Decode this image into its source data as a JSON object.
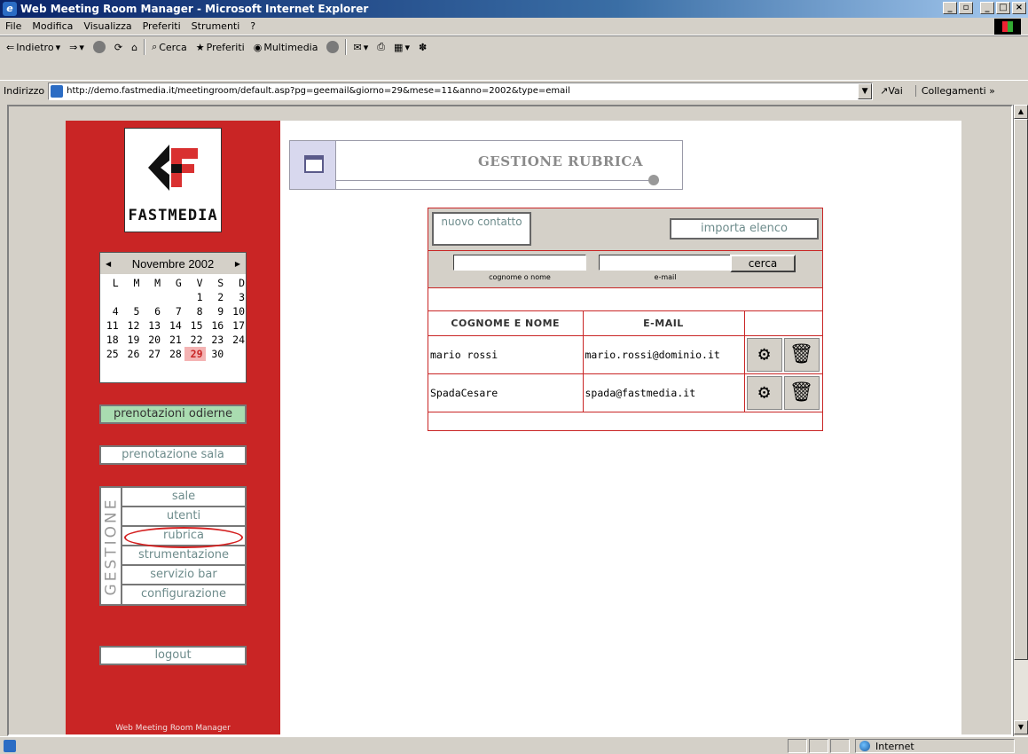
{
  "window": {
    "title": "Web Meeting Room Manager - Microsoft Internet Explorer"
  },
  "menu": [
    "File",
    "Modifica",
    "Visualizza",
    "Preferiti",
    "Strumenti",
    "?"
  ],
  "toolbar": {
    "back": "Indietro",
    "search": "Cerca",
    "favorites": "Preferiti",
    "media": "Multimedia"
  },
  "address": {
    "label": "Indirizzo",
    "url": "http://demo.fastmedia.it/meetingroom/default.asp?pg=geemail&giorno=29&mese=11&anno=2002&type=email",
    "go": "Vai",
    "links": "Collegamenti"
  },
  "sidebar": {
    "brand": "FASTMEDIA",
    "calendar": {
      "month": "Novembre 2002",
      "weekdays": [
        "L",
        "M",
        "M",
        "G",
        "V",
        "S",
        "D"
      ],
      "weeks": [
        [
          "",
          "",
          "",
          "",
          "1",
          "2",
          "3"
        ],
        [
          "4",
          "5",
          "6",
          "7",
          "8",
          "9",
          "10"
        ],
        [
          "11",
          "12",
          "13",
          "14",
          "15",
          "16",
          "17"
        ],
        [
          "18",
          "19",
          "20",
          "21",
          "22",
          "23",
          "24"
        ],
        [
          "25",
          "26",
          "27",
          "28",
          "29",
          "30",
          ""
        ]
      ],
      "today": "29"
    },
    "today_bookings": "prenotazioni odierne",
    "room_booking": "prenotazione sala",
    "gestione_label": "GESTIONE",
    "gestione": [
      "sale",
      "utenti",
      "rubrica",
      "strumentazione",
      "servizio bar",
      "configurazione"
    ],
    "logout": "logout",
    "footer": "Web Meeting Room Manager"
  },
  "main": {
    "title": "GESTIONE RUBRICA",
    "new_contact": "nuovo contatto",
    "import_list": "importa elenco",
    "search_name_label": "cognome o nome",
    "search_email_label": "e-mail",
    "search_button": "cerca",
    "columns": [
      "COGNOME E NOME",
      "E-MAIL"
    ],
    "rows": [
      {
        "name": "mario rossi",
        "email": "mario.rossi@dominio.it"
      },
      {
        "name": "SpadaCesare",
        "email": "spada@fastmedia.it"
      }
    ]
  },
  "status": {
    "zone": "Internet"
  }
}
